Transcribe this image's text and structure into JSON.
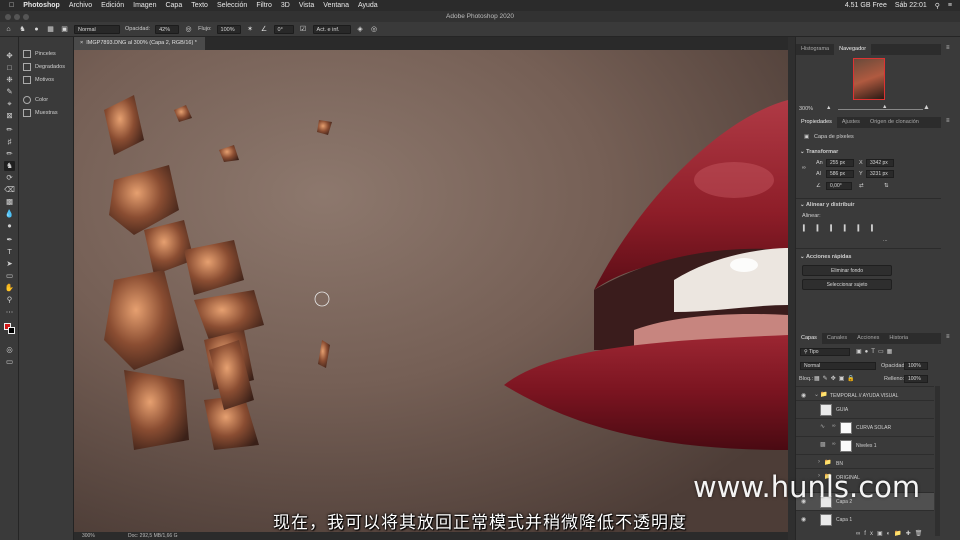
{
  "mac_menu": {
    "app": "Photoshop",
    "items": [
      "Archivo",
      "Edición",
      "Imagen",
      "Capa",
      "Texto",
      "Selección",
      "Filtro",
      "3D",
      "Vista",
      "Ventana",
      "Ayuda"
    ],
    "right": {
      "storage": "4.51 GB Free",
      "datetime": "Sáb 22:01"
    }
  },
  "window_title": "Adobe Photoshop 2020",
  "options_bar": {
    "mode": "Normal",
    "opacity_label": "Opacidad:",
    "opacity_value": "42%",
    "flow_label": "Flujo:",
    "flow_value": "100%",
    "angle_value": "0°",
    "sample_value": "Act. e inf."
  },
  "doc_tab": {
    "title": "IMGP7893.DNG al 300% (Capa 2, RGB/16) *"
  },
  "left_strip": {
    "items": [
      "Pinceles",
      "Degradados",
      "Motivos",
      "Color",
      "Muestras"
    ]
  },
  "status": {
    "zoom": "300%",
    "doc": "Doc: 292,5 MB/1,66 G"
  },
  "navigator": {
    "tabs": [
      "Histograma",
      "Navegador"
    ],
    "active_tab": "Navegador",
    "zoom": "300%"
  },
  "properties": {
    "tabs": [
      "Propiedades",
      "Ajustes",
      "Origen de clonación"
    ],
    "layer_type": "Capa de píxeles",
    "transform_label": "Transformar",
    "w_label": "An",
    "w_value": "255 px",
    "h_label": "Al",
    "h_value": "586 px",
    "x_label": "X",
    "x_value": "3342 px",
    "y_label": "Y",
    "y_value": "3231 px",
    "angle_value": "0,00°",
    "align_label": "Alinear y distribuir",
    "align_sub": "Alinear:",
    "quick_label": "Acciones rápidas",
    "remove_bg": "Eliminar fondo",
    "select_subject": "Seleccionar sujeto",
    "more": "..."
  },
  "layers_panel": {
    "tabs": [
      "Capas",
      "Canales",
      "Acciones",
      "Historia"
    ],
    "filter": "Tipo",
    "blend_mode": "Normal",
    "opacity_label": "Opacidad:",
    "opacity_value": "100%",
    "lock_label": "Bloq.:",
    "fill_label": "Relleno:",
    "fill_value": "100%",
    "layers": [
      {
        "name": "TEMPORAL // AYUDA VISUAL",
        "kind": "group",
        "visible": true
      },
      {
        "name": "GUIA",
        "kind": "pixel",
        "visible": false
      },
      {
        "name": "CURVA SOLAR",
        "kind": "adjust",
        "visible": false
      },
      {
        "name": "Niveles 1",
        "kind": "adjust",
        "visible": false
      },
      {
        "name": "BN",
        "kind": "group",
        "visible": false
      },
      {
        "name": "ORIGINAL",
        "kind": "group",
        "visible": false
      },
      {
        "name": "Capa 2",
        "kind": "pixel",
        "visible": true,
        "selected": true
      },
      {
        "name": "Capa 1",
        "kind": "pixel",
        "visible": true
      }
    ]
  },
  "subtitle": "现在，我可以将其放回正常模式并稍微降低不透明度",
  "watermark": "www.hunls.com",
  "colors": {
    "foreground": "#d01818",
    "background": "#000000",
    "lip": "#8a1a22",
    "skin": "#7a655a"
  }
}
